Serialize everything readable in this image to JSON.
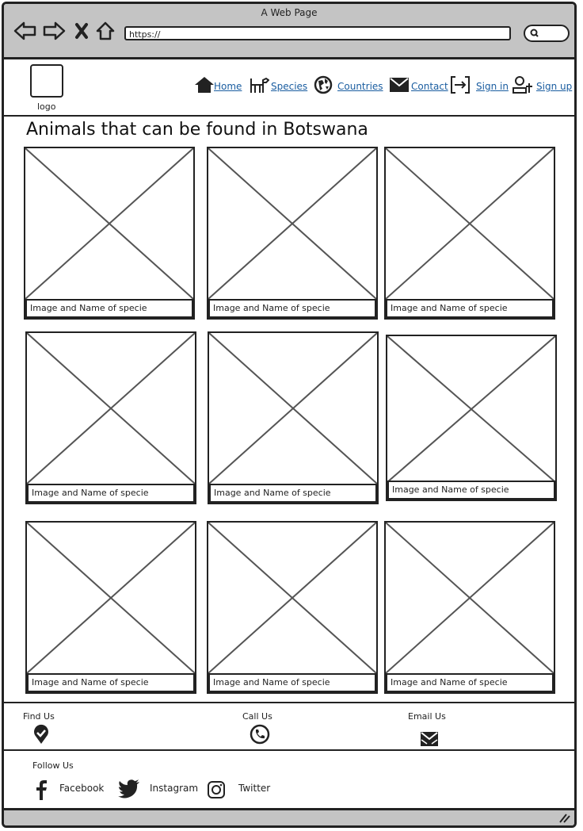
{
  "browser": {
    "window_title": "A Web Page",
    "url": "https://"
  },
  "header": {
    "logo_label": "logo",
    "nav": [
      {
        "label": "Home",
        "icon": "home-icon"
      },
      {
        "label": "Species",
        "icon": "dog-icon"
      },
      {
        "label": "Countries",
        "icon": "globe-icon"
      },
      {
        "label": "Contact",
        "icon": "envelope-icon"
      },
      {
        "label": "Sign in",
        "icon": "sign-in-icon"
      },
      {
        "label": "Sign up",
        "icon": "user-add-icon"
      }
    ]
  },
  "main": {
    "title": "Animals that can be found in Botswana",
    "cards": [
      {
        "caption": "Image and Name of specie"
      },
      {
        "caption": "Image and Name of specie"
      },
      {
        "caption": "Image and Name of specie"
      },
      {
        "caption": "Image and Name of specie"
      },
      {
        "caption": "Image and Name of specie"
      },
      {
        "caption": "Image and Name of specie"
      },
      {
        "caption": "Image and Name of specie"
      },
      {
        "caption": "Image and Name of specie"
      },
      {
        "caption": "Image and Name of specie"
      }
    ]
  },
  "footer": {
    "contact": [
      {
        "label": "Find Us",
        "icon": "map-marker-icon"
      },
      {
        "label": "Call Us",
        "icon": "phone-icon"
      },
      {
        "label": "Email Us",
        "icon": "envelope-icon"
      }
    ],
    "follow_title": "Follow Us",
    "social": [
      {
        "label": "Facebook",
        "icon": "facebook-icon"
      },
      {
        "label": "Instagram",
        "icon": "twitter-icon"
      },
      {
        "label": "Twitter",
        "icon": "instagram-icon"
      }
    ]
  }
}
